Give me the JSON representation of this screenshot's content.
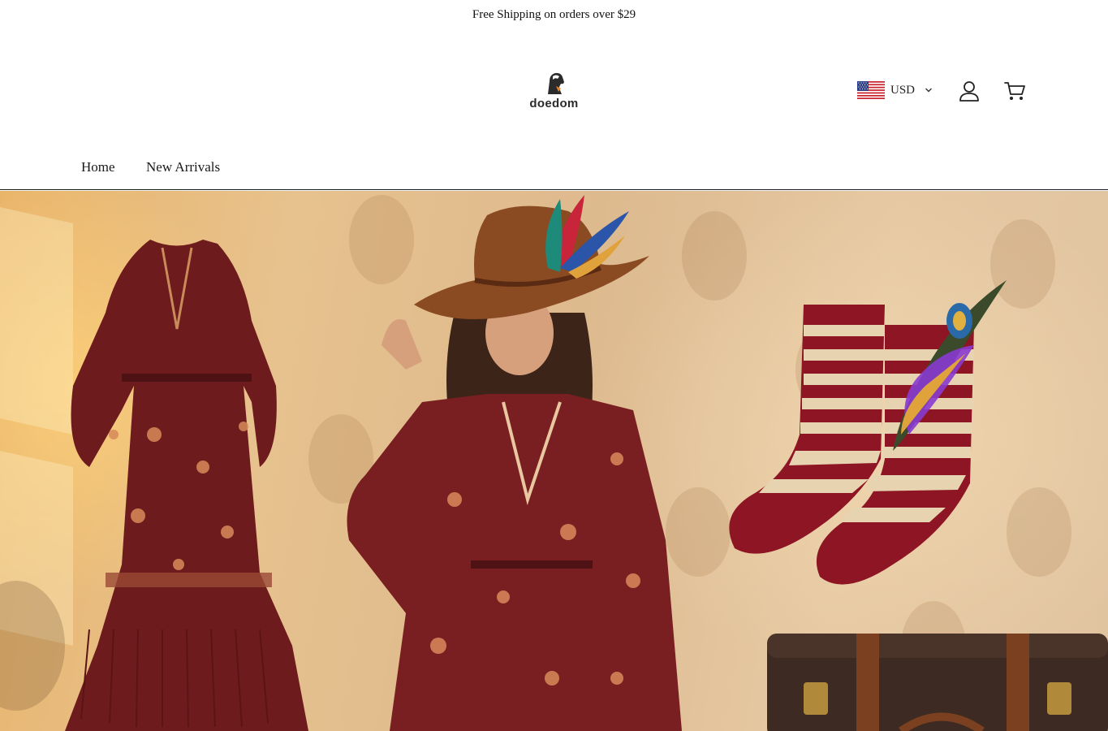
{
  "announcement": {
    "text": "Free Shipping on orders over $29"
  },
  "brand": {
    "name": "doedom"
  },
  "header": {
    "currency": {
      "code": "USD",
      "flag": "us-flag-icon"
    },
    "account_icon": "user-icon",
    "cart_icon": "cart-icon"
  },
  "nav": {
    "items": [
      {
        "label": "Home"
      },
      {
        "label": "New Arrivals"
      }
    ]
  },
  "hero": {
    "image": "bohemian-fashion-banner"
  },
  "colors": {
    "text": "#1a1a1a",
    "background": "#ffffff",
    "dress": "#7a1f1f",
    "hat": "#8a4a22",
    "sock_red": "#8d1524",
    "sock_cream": "#e8d3b0",
    "suitcase": "#3d2a22"
  }
}
